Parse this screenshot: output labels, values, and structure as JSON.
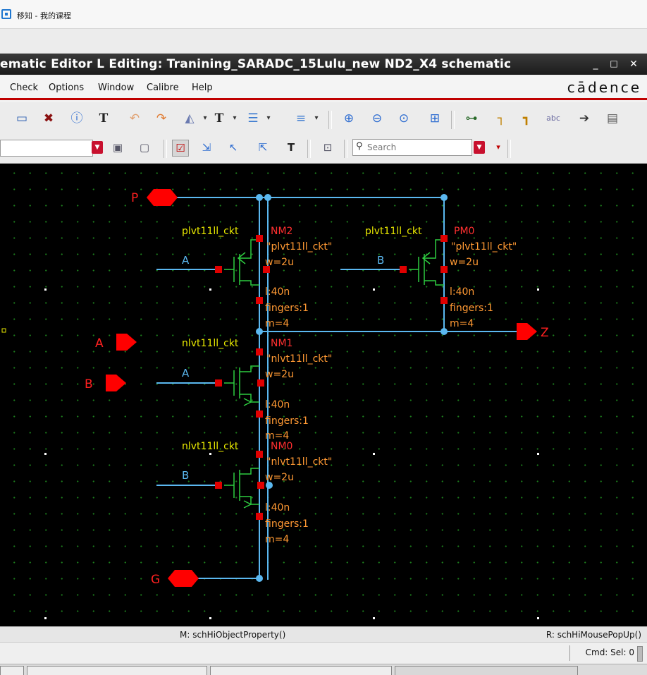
{
  "host": {
    "title": "移知 - 我的课程"
  },
  "window": {
    "title": "ematic Editor L Editing: Tranining_SARADC_15Lulu_new ND2_X4 schematic"
  },
  "menu": {
    "items": [
      "Check",
      "Options",
      "Window",
      "Calibre",
      "Help"
    ],
    "brand": "cādence"
  },
  "search": {
    "placeholder": "Search"
  },
  "schematic": {
    "pins": {
      "P": "P",
      "Z": "Z",
      "A": "A",
      "B": "B",
      "G": "G"
    },
    "instances": [
      {
        "model": "plvt11ll_ckt",
        "name": "NM2",
        "cell": "\"plvt11ll_ckt\"",
        "w": "w=2u",
        "l": "l:40n",
        "fingers": "fingers:1",
        "m": "m=4",
        "gate": "A"
      },
      {
        "model": "plvt11ll_ckt",
        "name": "PM0",
        "cell": "\"plvt11ll_ckt\"",
        "w": "w=2u",
        "l": "l:40n",
        "fingers": "fingers:1",
        "m": "m=4",
        "gate": "B"
      },
      {
        "model": "nlvt11ll_ckt",
        "name": "NM1",
        "cell": "\"nlvt11ll_ckt\"",
        "w": "w=2u",
        "l": "l:40n",
        "fingers": "fingers:1",
        "m": "m=4",
        "gate": "A"
      },
      {
        "model": "nlvt11ll_ckt",
        "name": "NM0",
        "cell": "\"nlvt11ll_ckt\"",
        "w": "w=2u",
        "l": "l:40n",
        "fingers": "fingers:1",
        "m": "m=4",
        "gate": "B"
      }
    ]
  },
  "status": {
    "mouse_mid": "M: schHiObjectProperty()",
    "mouse_right": "R: schHiMousePopUp()",
    "cmd_sel": "Cmd: Sel: 0"
  },
  "colors": {
    "wire": "#5bb8f0",
    "pin": "#ff0000",
    "label_yellow": "#e8e800",
    "label_orange": "#ff9933",
    "label_red": "#ff3030",
    "grid": "#1c7d1c",
    "accent_red": "#c00000"
  },
  "icons": [
    "window-icon",
    "minimize-icon",
    "maximize-icon",
    "close-icon",
    "fit-icon",
    "delete-icon",
    "info-icon",
    "text-icon",
    "undo-icon",
    "redo-icon",
    "stretch-icon",
    "label-icon",
    "align-icon",
    "distribute-icon",
    "zoom-in-icon",
    "zoom-out-icon",
    "zoom-fit-icon",
    "zoom-area-icon",
    "add-instance-icon",
    "wire-icon",
    "wide-wire-icon",
    "wire-label-icon",
    "pin-icon",
    "note-icon",
    "search-icon"
  ]
}
